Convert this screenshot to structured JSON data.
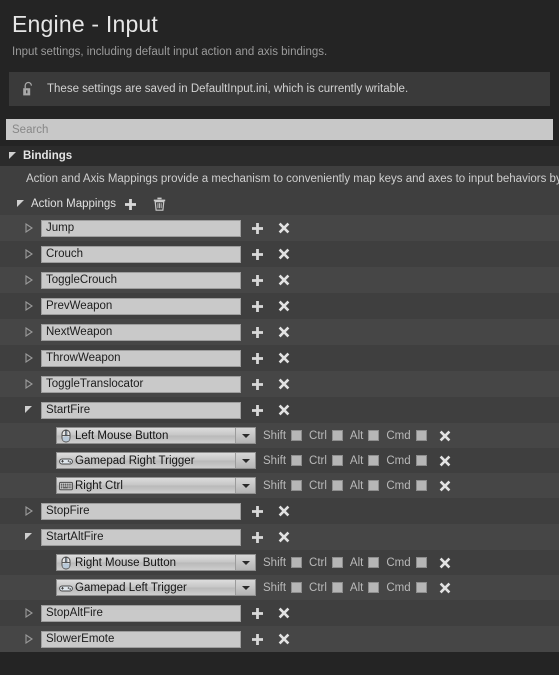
{
  "header": {
    "title": "Engine - Input",
    "subtitle": "Input settings, including default input action and axis bindings."
  },
  "notice": {
    "icon": "unlocked-padlock-icon",
    "text": "These settings are saved in DefaultInput.ini, which is currently writable."
  },
  "search": {
    "placeholder": "Search",
    "value": ""
  },
  "bindings": {
    "section_label": "Bindings",
    "description": "Action and Axis Mappings provide a mechanism to conveniently map keys and axes to input behaviors by",
    "action_mappings": {
      "label": "Action Mappings",
      "add_icon": "plus-icon",
      "delete_icon": "trash-icon"
    }
  },
  "modifiers": [
    "Shift",
    "Ctrl",
    "Alt",
    "Cmd"
  ],
  "rows": [
    {
      "name": "Jump",
      "expanded": false,
      "stripe": "alt",
      "keys": []
    },
    {
      "name": "Crouch",
      "expanded": false,
      "stripe": "norm",
      "keys": []
    },
    {
      "name": "ToggleCrouch",
      "expanded": false,
      "stripe": "alt",
      "keys": []
    },
    {
      "name": "PrevWeapon",
      "expanded": false,
      "stripe": "norm",
      "keys": []
    },
    {
      "name": "NextWeapon",
      "expanded": false,
      "stripe": "alt",
      "keys": []
    },
    {
      "name": "ThrowWeapon",
      "expanded": false,
      "stripe": "norm",
      "keys": []
    },
    {
      "name": "ToggleTranslocator",
      "expanded": false,
      "stripe": "alt",
      "keys": []
    },
    {
      "name": "StartFire",
      "expanded": true,
      "stripe": "norm",
      "keys": [
        {
          "label": "Left Mouse Button",
          "icon": "mouse-icon",
          "stripe": "alt",
          "shift": false,
          "ctrl": false,
          "alt": false,
          "cmd": false
        },
        {
          "label": "Gamepad Right Trigger",
          "icon": "gamepad-icon",
          "stripe": "norm",
          "shift": false,
          "ctrl": false,
          "alt": false,
          "cmd": false
        },
        {
          "label": "Right Ctrl",
          "icon": "keyboard-icon",
          "stripe": "alt",
          "shift": false,
          "ctrl": false,
          "alt": false,
          "cmd": false
        }
      ]
    },
    {
      "name": "StopFire",
      "expanded": false,
      "stripe": "norm",
      "keys": []
    },
    {
      "name": "StartAltFire",
      "expanded": true,
      "stripe": "alt",
      "keys": [
        {
          "label": "Right Mouse Button",
          "icon": "mouse-icon",
          "stripe": "norm",
          "shift": false,
          "ctrl": false,
          "alt": false,
          "cmd": false
        },
        {
          "label": "Gamepad Left Trigger",
          "icon": "gamepad-icon",
          "stripe": "alt",
          "shift": false,
          "ctrl": false,
          "alt": false,
          "cmd": false
        }
      ]
    },
    {
      "name": "StopAltFire",
      "expanded": false,
      "stripe": "norm",
      "keys": []
    },
    {
      "name": "SlowerEmote",
      "expanded": false,
      "stripe": "alt",
      "keys": []
    }
  ],
  "colors": {
    "background": "#242424",
    "panel": "#3f3f3f",
    "panel_alt": "#464646",
    "notice_bg": "#3a3a3a",
    "field_bg": "#c9c9c9",
    "text_primary": "#e6e6e6",
    "text_muted": "#9b9b9b"
  }
}
